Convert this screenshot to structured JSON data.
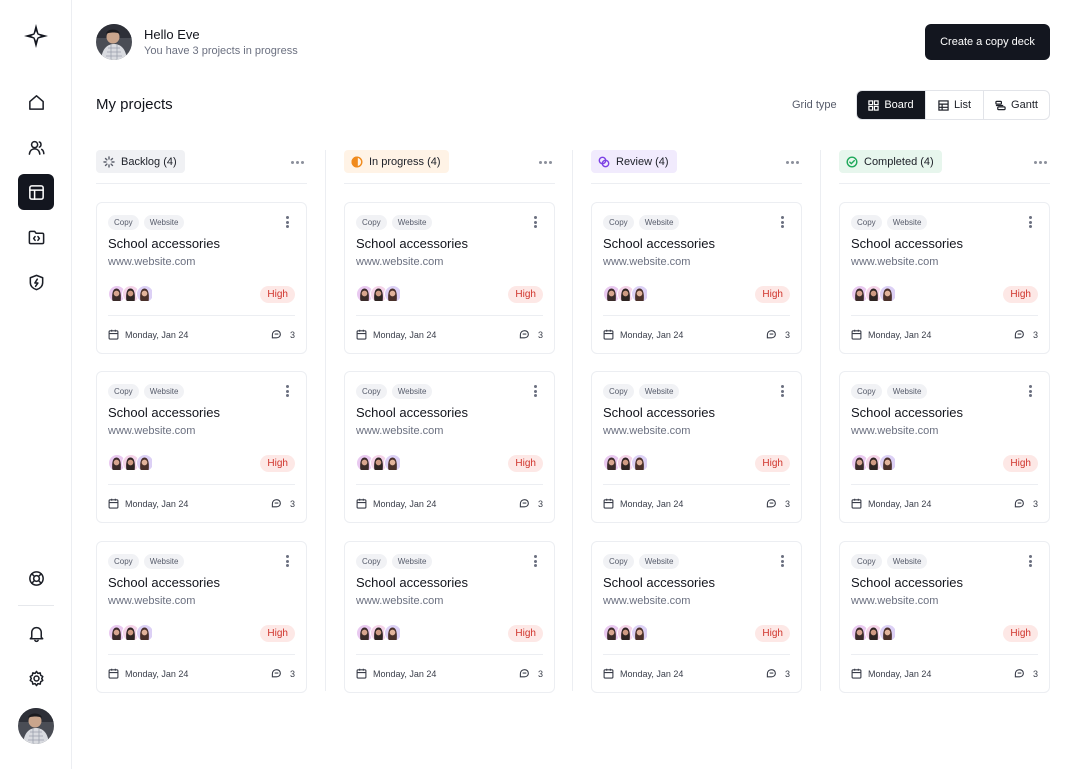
{
  "user": {
    "greeting": "Hello Eve",
    "status": "You have 3 projects in progress"
  },
  "header": {
    "cta_label": "Create a copy deck",
    "page_title": "My projects",
    "grid_type_label": "Grid type",
    "views": [
      "Board",
      "List",
      "Gantt"
    ],
    "active_view": "Board"
  },
  "sidebar": {
    "items": [
      {
        "icon": "home-icon"
      },
      {
        "icon": "users-icon"
      },
      {
        "icon": "layout-icon",
        "active": true
      },
      {
        "icon": "folder-code-icon"
      },
      {
        "icon": "shield-bolt-icon"
      }
    ],
    "bottom": [
      {
        "icon": "lifebuoy-icon"
      },
      {
        "icon": "bell-icon"
      },
      {
        "icon": "gear-icon"
      }
    ]
  },
  "columns": [
    {
      "title": "Backlog (4)",
      "icon": "loader-icon",
      "color": "#5c606c",
      "bg": "#f0f1f4",
      "cards": [
        {
          "tags": [
            "Copy",
            "Website"
          ],
          "title": "School accessories",
          "url": "www.website.com",
          "priority": "High",
          "date": "Monday, Jan 24",
          "comments": "3"
        },
        {
          "tags": [
            "Copy",
            "Website"
          ],
          "title": "School accessories",
          "url": "www.website.com",
          "priority": "High",
          "date": "Monday, Jan 24",
          "comments": "3"
        },
        {
          "tags": [
            "Copy",
            "Website"
          ],
          "title": "School accessories",
          "url": "www.website.com",
          "priority": "High",
          "date": "Monday, Jan 24",
          "comments": "3"
        }
      ]
    },
    {
      "title": "In progress (4)",
      "icon": "half-circle-icon",
      "color": "#f08a1c",
      "bg": "#fff3e6",
      "cards": [
        {
          "tags": [
            "Copy",
            "Website"
          ],
          "title": "School accessories",
          "url": "www.website.com",
          "priority": "High",
          "date": "Monday, Jan 24",
          "comments": "3"
        },
        {
          "tags": [
            "Copy",
            "Website"
          ],
          "title": "School accessories",
          "url": "www.website.com",
          "priority": "High",
          "date": "Monday, Jan 24",
          "comments": "3"
        },
        {
          "tags": [
            "Copy",
            "Website"
          ],
          "title": "School accessories",
          "url": "www.website.com",
          "priority": "High",
          "date": "Monday, Jan 24",
          "comments": "3"
        }
      ]
    },
    {
      "title": "Review (4)",
      "icon": "review-icon",
      "color": "#7b3fe4",
      "bg": "#f1ebfd",
      "cards": [
        {
          "tags": [
            "Copy",
            "Website"
          ],
          "title": "School accessories",
          "url": "www.website.com",
          "priority": "High",
          "date": "Monday, Jan 24",
          "comments": "3"
        },
        {
          "tags": [
            "Copy",
            "Website"
          ],
          "title": "School accessories",
          "url": "www.website.com",
          "priority": "High",
          "date": "Monday, Jan 24",
          "comments": "3"
        },
        {
          "tags": [
            "Copy",
            "Website"
          ],
          "title": "School accessories",
          "url": "www.website.com",
          "priority": "High",
          "date": "Monday, Jan 24",
          "comments": "3"
        }
      ]
    },
    {
      "title": "Completed (4)",
      "icon": "check-circle-icon",
      "color": "#1fa85a",
      "bg": "#e7f6ed",
      "cards": [
        {
          "tags": [
            "Copy",
            "Website"
          ],
          "title": "School accessories",
          "url": "www.website.com",
          "priority": "High",
          "date": "Monday, Jan 24",
          "comments": "3"
        },
        {
          "tags": [
            "Copy",
            "Website"
          ],
          "title": "School accessories",
          "url": "www.website.com",
          "priority": "High",
          "date": "Monday, Jan 24",
          "comments": "3"
        },
        {
          "tags": [
            "Copy",
            "Website"
          ],
          "title": "School accessories",
          "url": "www.website.com",
          "priority": "High",
          "date": "Monday, Jan 24",
          "comments": "3"
        }
      ]
    }
  ]
}
